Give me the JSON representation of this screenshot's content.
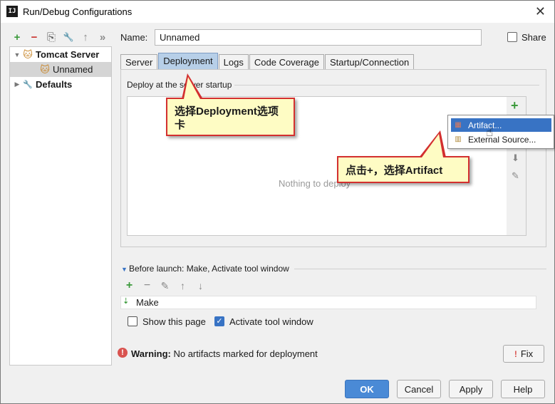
{
  "window": {
    "title": "Run/Debug Configurations",
    "close_glyph": "✕"
  },
  "left_toolbar": [
    {
      "name": "add-config-button",
      "glyph": "+",
      "color": "#3c9a3c"
    },
    {
      "name": "remove-config-button",
      "glyph": "−",
      "color": "#c9302c"
    },
    {
      "name": "copy-config-button",
      "glyph": "⎘",
      "color": "#5a5a5a"
    },
    {
      "name": "edit-defaults-button",
      "glyph": "🔧",
      "color": "#5a5a5a"
    },
    {
      "name": "move-up-button",
      "glyph": "↑",
      "color": "#8a8a8a"
    },
    {
      "name": "more-button",
      "glyph": "»",
      "color": "#8a8a8a"
    }
  ],
  "tree": {
    "items": [
      {
        "label": "Tomcat Server",
        "icon": "tomcat-icon",
        "arrow": "▼"
      },
      {
        "label": "Unnamed",
        "icon": "tomcat-icon"
      },
      {
        "label": "Defaults",
        "icon": "wrench-icon",
        "arrow": "▶"
      }
    ]
  },
  "name_field": {
    "label": "Name:",
    "value": "Unnamed"
  },
  "share": {
    "label": "Share",
    "checked": false
  },
  "tabs": [
    "Server",
    "Deployment",
    "Logs",
    "Code Coverage",
    "Startup/Connection"
  ],
  "active_tab": "Deployment",
  "deploy": {
    "group_title": "Deploy at the server startup",
    "empty_text": "Nothing to deploy",
    "add_glyph": "+",
    "down_glyph": "⬇",
    "edit_glyph": "✎"
  },
  "popup_menu": {
    "items": [
      {
        "label": "Artifact...",
        "icon": "artifact-icon",
        "highlighted": true
      },
      {
        "label": "External Source...",
        "icon": "external-source-icon",
        "highlighted": false
      }
    ]
  },
  "callouts": {
    "tab_hint": "选择Deployment选项卡",
    "plus_hint": "点击+，选择Artifact"
  },
  "before_launch": {
    "arrow_glyph": "▼",
    "title": "Before launch: Make, Activate tool window",
    "toolbar": [
      "+",
      "−",
      "✎",
      "↑",
      "↓"
    ],
    "item_glyph": "⇣",
    "items": [
      "Make"
    ]
  },
  "options": {
    "show_this_page": {
      "label": "Show this page",
      "checked": false
    },
    "activate_tool_window": {
      "label": "Activate tool window",
      "checked": true
    }
  },
  "warning": {
    "icon_glyph": "!",
    "label": "Warning:",
    "message": "No artifacts marked for deployment",
    "fix_label": "Fix",
    "fix_glyph": "!"
  },
  "buttons": {
    "ok": "OK",
    "cancel": "Cancel",
    "apply": "Apply",
    "help": "Help"
  },
  "colors": {
    "accent": "#4a8ad6",
    "callout_border": "#d32f2f",
    "callout_fill": "#fefcc4",
    "menu_highlight": "#3873c4"
  }
}
